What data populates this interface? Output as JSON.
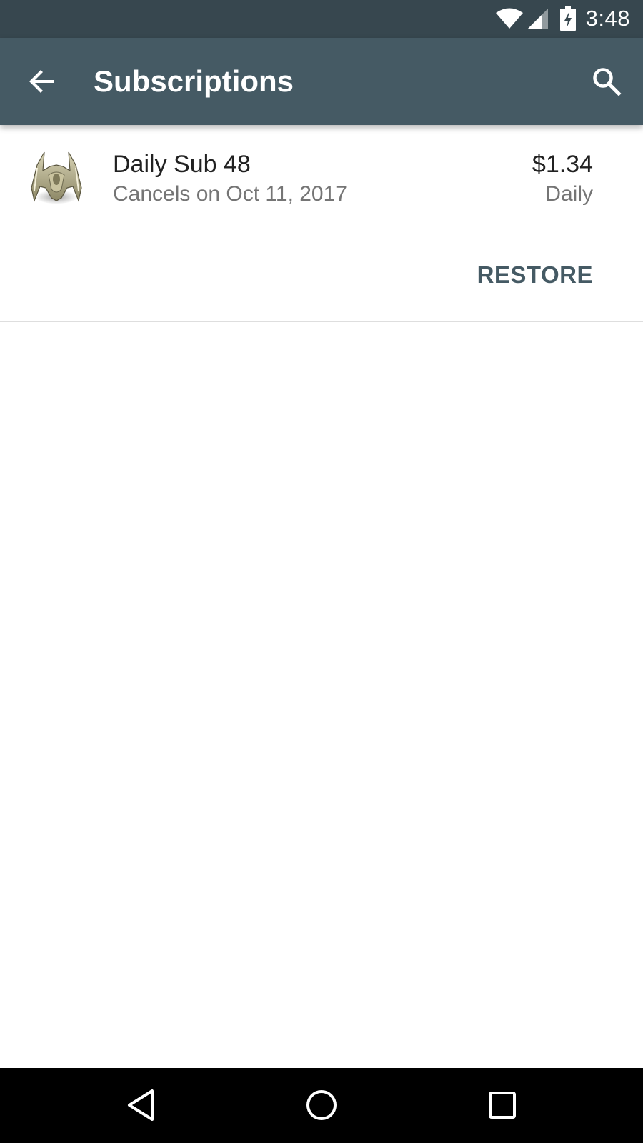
{
  "status_bar": {
    "time": "3:48",
    "icons": [
      "wifi-icon",
      "cell-signal-icon",
      "battery-charging-icon"
    ]
  },
  "app_bar": {
    "title": "Subscriptions",
    "back_icon": "arrow-back-icon",
    "search_icon": "search-icon",
    "background": "#455a64"
  },
  "subscription": {
    "name": "Daily Sub 48",
    "status": "Cancels on Oct 11, 2017",
    "price": "$1.34",
    "period": "Daily",
    "restore_label": "RESTORE",
    "icon": "spaceship-app-icon"
  },
  "nav_bar": {
    "icons": [
      "nav-back-icon",
      "nav-home-icon",
      "nav-recents-icon"
    ]
  },
  "colors": {
    "status_bar": "#37474f",
    "app_bar": "#455a64",
    "accent": "#455a64"
  }
}
